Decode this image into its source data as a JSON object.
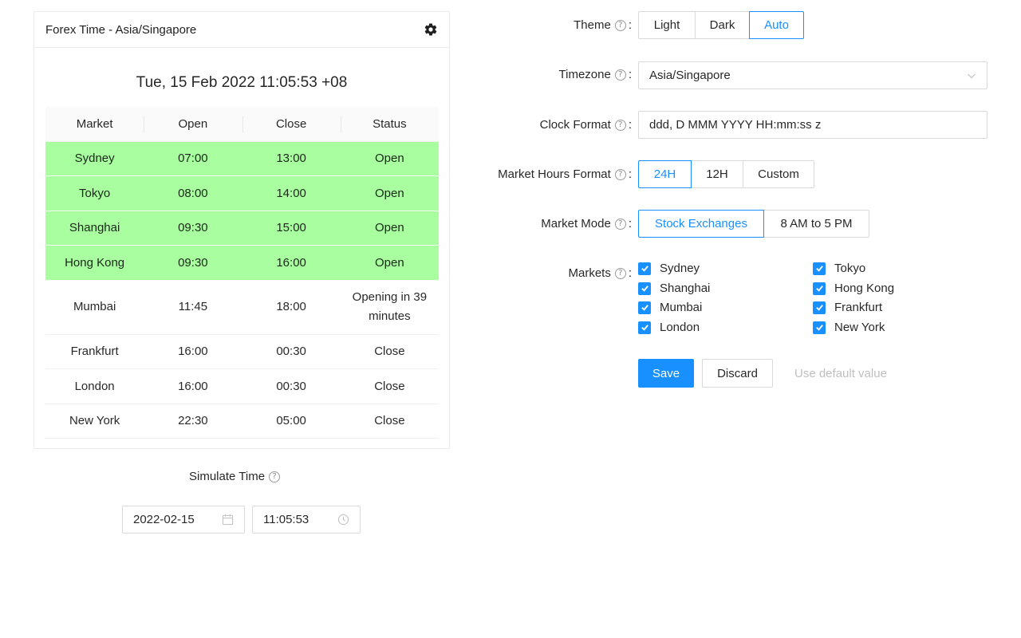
{
  "card": {
    "title": "Forex Time - Asia/Singapore",
    "clock": "Tue, 15 Feb 2022 11:05:53 +08",
    "columns": [
      "Market",
      "Open",
      "Close",
      "Status"
    ],
    "rows": [
      {
        "market": "Sydney",
        "open": "07:00",
        "close": "13:00",
        "status": "Open"
      },
      {
        "market": "Tokyo",
        "open": "08:00",
        "close": "14:00",
        "status": "Open"
      },
      {
        "market": "Shanghai",
        "open": "09:30",
        "close": "15:00",
        "status": "Open"
      },
      {
        "market": "Hong Kong",
        "open": "09:30",
        "close": "16:00",
        "status": "Open"
      },
      {
        "market": "Mumbai",
        "open": "11:45",
        "close": "18:00",
        "status": "Opening in 39 minutes"
      },
      {
        "market": "Frankfurt",
        "open": "16:00",
        "close": "00:30",
        "status": "Close"
      },
      {
        "market": "London",
        "open": "16:00",
        "close": "00:30",
        "status": "Close"
      },
      {
        "market": "New York",
        "open": "22:30",
        "close": "05:00",
        "status": "Close"
      }
    ]
  },
  "simulate": {
    "label": "Simulate Time",
    "date": "2022-02-15",
    "time": "11:05:53"
  },
  "form": {
    "theme": {
      "label": "Theme",
      "options": [
        "Light",
        "Dark",
        "Auto"
      ],
      "selected": "Auto"
    },
    "timezone": {
      "label": "Timezone",
      "value": "Asia/Singapore"
    },
    "clock_format": {
      "label": "Clock Format",
      "value": "ddd, D MMM YYYY HH:mm:ss z"
    },
    "market_hours_format": {
      "label": "Market Hours Format",
      "options": [
        "24H",
        "12H",
        "Custom"
      ],
      "selected": "24H"
    },
    "market_mode": {
      "label": "Market Mode",
      "options": [
        "Stock Exchanges",
        "8 AM to 5 PM"
      ],
      "selected": "Stock Exchanges"
    },
    "markets": {
      "label": "Markets",
      "items": [
        {
          "name": "Sydney",
          "checked": true
        },
        {
          "name": "Tokyo",
          "checked": true
        },
        {
          "name": "Shanghai",
          "checked": true
        },
        {
          "name": "Hong Kong",
          "checked": true
        },
        {
          "name": "Mumbai",
          "checked": true
        },
        {
          "name": "Frankfurt",
          "checked": true
        },
        {
          "name": "London",
          "checked": true
        },
        {
          "name": "New York",
          "checked": true
        }
      ]
    },
    "buttons": {
      "save": "Save",
      "discard": "Discard",
      "default": "Use default value"
    }
  },
  "colors": {
    "accent": "#1890ff",
    "open_row": "#a9ff9f"
  },
  "help_glyph": "?"
}
